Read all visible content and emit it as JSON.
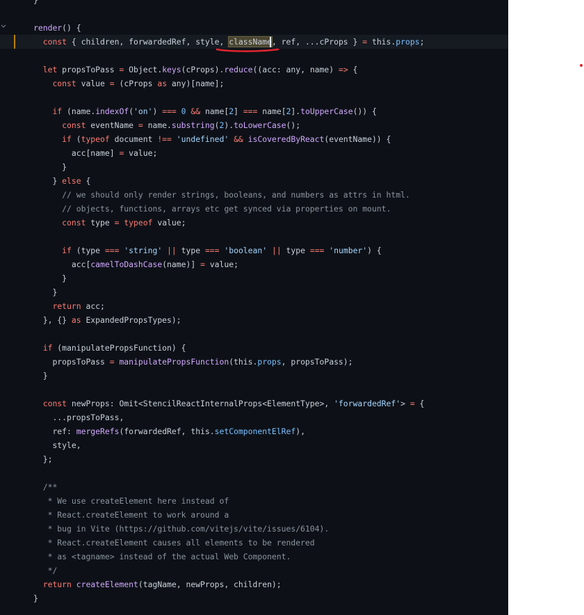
{
  "colors": {
    "editor_bg": "#0d1117",
    "keyword": "#ff7b72",
    "function": "#d2a8ff",
    "string": "#a5d6ff",
    "comment": "#8b949e",
    "property": "#79c0ff",
    "plain": "#c9d1d9",
    "annotation": "#e0242e",
    "right_panel_bg": "#ffffff"
  },
  "icons": {
    "fold": "chevron-down-icon"
  },
  "editor": {
    "lines": [
      {
        "tokens": [
          {
            "t": "    }",
            "c": "n"
          }
        ]
      },
      {
        "tokens": []
      },
      {
        "tokens": [
          {
            "t": "    ",
            "c": "n"
          },
          {
            "t": "render",
            "c": "f"
          },
          {
            "t": "() {",
            "c": "n"
          }
        ]
      },
      {
        "active": true,
        "tokens": [
          {
            "t": "      ",
            "c": "n"
          },
          {
            "t": "const",
            "c": "k"
          },
          {
            "t": " { children, forwardedRef, style, ",
            "c": "n"
          },
          {
            "t": "className",
            "c": "n",
            "hl": true
          },
          {
            "t": ", ref, ...cProps } ",
            "c": "n"
          },
          {
            "t": "=",
            "c": "o"
          },
          {
            "t": " this.",
            "c": "n"
          },
          {
            "t": "props",
            "c": "p"
          },
          {
            "t": ";",
            "c": "n"
          }
        ]
      },
      {
        "tokens": []
      },
      {
        "tokens": [
          {
            "t": "      ",
            "c": "n"
          },
          {
            "t": "let",
            "c": "k"
          },
          {
            "t": " propsToPass ",
            "c": "n"
          },
          {
            "t": "=",
            "c": "o"
          },
          {
            "t": " Object.",
            "c": "n"
          },
          {
            "t": "keys",
            "c": "f"
          },
          {
            "t": "(cProps).",
            "c": "n"
          },
          {
            "t": "reduce",
            "c": "f"
          },
          {
            "t": "((acc: any, name) ",
            "c": "n"
          },
          {
            "t": "=>",
            "c": "k"
          },
          {
            "t": " {",
            "c": "n"
          }
        ]
      },
      {
        "tokens": [
          {
            "t": "        ",
            "c": "n"
          },
          {
            "t": "const",
            "c": "k"
          },
          {
            "t": " value ",
            "c": "n"
          },
          {
            "t": "=",
            "c": "o"
          },
          {
            "t": " (cProps ",
            "c": "n"
          },
          {
            "t": "as",
            "c": "k"
          },
          {
            "t": " any)[name];",
            "c": "n"
          }
        ]
      },
      {
        "tokens": []
      },
      {
        "tokens": [
          {
            "t": "        ",
            "c": "n"
          },
          {
            "t": "if",
            "c": "k"
          },
          {
            "t": " (name.",
            "c": "n"
          },
          {
            "t": "indexOf",
            "c": "f"
          },
          {
            "t": "(",
            "c": "n"
          },
          {
            "t": "'on'",
            "c": "s"
          },
          {
            "t": ") ",
            "c": "n"
          },
          {
            "t": "===",
            "c": "o"
          },
          {
            "t": " ",
            "c": "n"
          },
          {
            "t": "0",
            "c": "p"
          },
          {
            "t": " ",
            "c": "n"
          },
          {
            "t": "&&",
            "c": "o"
          },
          {
            "t": " name[",
            "c": "n"
          },
          {
            "t": "2",
            "c": "p"
          },
          {
            "t": "] ",
            "c": "n"
          },
          {
            "t": "===",
            "c": "o"
          },
          {
            "t": " name[",
            "c": "n"
          },
          {
            "t": "2",
            "c": "p"
          },
          {
            "t": "].",
            "c": "n"
          },
          {
            "t": "toUpperCase",
            "c": "f"
          },
          {
            "t": "()) {",
            "c": "n"
          }
        ]
      },
      {
        "tokens": [
          {
            "t": "          ",
            "c": "n"
          },
          {
            "t": "const",
            "c": "k"
          },
          {
            "t": " eventName ",
            "c": "n"
          },
          {
            "t": "=",
            "c": "o"
          },
          {
            "t": " name.",
            "c": "n"
          },
          {
            "t": "substring",
            "c": "f"
          },
          {
            "t": "(",
            "c": "n"
          },
          {
            "t": "2",
            "c": "p"
          },
          {
            "t": ").",
            "c": "n"
          },
          {
            "t": "toLowerCase",
            "c": "f"
          },
          {
            "t": "();",
            "c": "n"
          }
        ]
      },
      {
        "tokens": [
          {
            "t": "          ",
            "c": "n"
          },
          {
            "t": "if",
            "c": "k"
          },
          {
            "t": " (",
            "c": "n"
          },
          {
            "t": "typeof",
            "c": "k"
          },
          {
            "t": " document ",
            "c": "n"
          },
          {
            "t": "!==",
            "c": "o"
          },
          {
            "t": " ",
            "c": "n"
          },
          {
            "t": "'undefined'",
            "c": "s"
          },
          {
            "t": " ",
            "c": "n"
          },
          {
            "t": "&&",
            "c": "o"
          },
          {
            "t": " ",
            "c": "n"
          },
          {
            "t": "isCoveredByReact",
            "c": "f"
          },
          {
            "t": "(eventName)) {",
            "c": "n"
          }
        ]
      },
      {
        "tokens": [
          {
            "t": "            acc[name] ",
            "c": "n"
          },
          {
            "t": "=",
            "c": "o"
          },
          {
            "t": " value;",
            "c": "n"
          }
        ]
      },
      {
        "tokens": [
          {
            "t": "          }",
            "c": "n"
          }
        ]
      },
      {
        "tokens": [
          {
            "t": "        } ",
            "c": "n"
          },
          {
            "t": "else",
            "c": "k"
          },
          {
            "t": " {",
            "c": "n"
          }
        ]
      },
      {
        "tokens": [
          {
            "t": "          ",
            "c": "n"
          },
          {
            "t": "// we should only render strings, booleans, and numbers as attrs in html.",
            "c": "c"
          }
        ]
      },
      {
        "tokens": [
          {
            "t": "          ",
            "c": "n"
          },
          {
            "t": "// objects, functions, arrays etc get synced via properties on mount.",
            "c": "c"
          }
        ]
      },
      {
        "tokens": [
          {
            "t": "          ",
            "c": "n"
          },
          {
            "t": "const",
            "c": "k"
          },
          {
            "t": " type ",
            "c": "n"
          },
          {
            "t": "=",
            "c": "o"
          },
          {
            "t": " ",
            "c": "n"
          },
          {
            "t": "typeof",
            "c": "k"
          },
          {
            "t": " value;",
            "c": "n"
          }
        ]
      },
      {
        "tokens": []
      },
      {
        "tokens": [
          {
            "t": "          ",
            "c": "n"
          },
          {
            "t": "if",
            "c": "k"
          },
          {
            "t": " (type ",
            "c": "n"
          },
          {
            "t": "===",
            "c": "o"
          },
          {
            "t": " ",
            "c": "n"
          },
          {
            "t": "'string'",
            "c": "s"
          },
          {
            "t": " ",
            "c": "n"
          },
          {
            "t": "||",
            "c": "o"
          },
          {
            "t": " type ",
            "c": "n"
          },
          {
            "t": "===",
            "c": "o"
          },
          {
            "t": " ",
            "c": "n"
          },
          {
            "t": "'boolean'",
            "c": "s"
          },
          {
            "t": " ",
            "c": "n"
          },
          {
            "t": "||",
            "c": "o"
          },
          {
            "t": " type ",
            "c": "n"
          },
          {
            "t": "===",
            "c": "o"
          },
          {
            "t": " ",
            "c": "n"
          },
          {
            "t": "'number'",
            "c": "s"
          },
          {
            "t": ") {",
            "c": "n"
          }
        ]
      },
      {
        "tokens": [
          {
            "t": "            acc[",
            "c": "n"
          },
          {
            "t": "camelToDashCase",
            "c": "f"
          },
          {
            "t": "(name)] ",
            "c": "n"
          },
          {
            "t": "=",
            "c": "o"
          },
          {
            "t": " value;",
            "c": "n"
          }
        ]
      },
      {
        "tokens": [
          {
            "t": "          }",
            "c": "n"
          }
        ]
      },
      {
        "tokens": [
          {
            "t": "        }",
            "c": "n"
          }
        ]
      },
      {
        "tokens": [
          {
            "t": "        ",
            "c": "n"
          },
          {
            "t": "return",
            "c": "k"
          },
          {
            "t": " acc;",
            "c": "n"
          }
        ]
      },
      {
        "tokens": [
          {
            "t": "      }, {} ",
            "c": "n"
          },
          {
            "t": "as",
            "c": "k"
          },
          {
            "t": " ExpandedPropsTypes);",
            "c": "n"
          }
        ]
      },
      {
        "tokens": []
      },
      {
        "tokens": [
          {
            "t": "      ",
            "c": "n"
          },
          {
            "t": "if",
            "c": "k"
          },
          {
            "t": " (manipulatePropsFunction) {",
            "c": "n"
          }
        ]
      },
      {
        "tokens": [
          {
            "t": "        propsToPass ",
            "c": "n"
          },
          {
            "t": "=",
            "c": "o"
          },
          {
            "t": " ",
            "c": "n"
          },
          {
            "t": "manipulatePropsFunction",
            "c": "f"
          },
          {
            "t": "(this.",
            "c": "n"
          },
          {
            "t": "props",
            "c": "p"
          },
          {
            "t": ", propsToPass);",
            "c": "n"
          }
        ]
      },
      {
        "tokens": [
          {
            "t": "      }",
            "c": "n"
          }
        ]
      },
      {
        "tokens": []
      },
      {
        "tokens": [
          {
            "t": "      ",
            "c": "n"
          },
          {
            "t": "const",
            "c": "k"
          },
          {
            "t": " newProps: Omit<StencilReactInternalProps<ElementType>, ",
            "c": "n"
          },
          {
            "t": "'forwardedRef'",
            "c": "s"
          },
          {
            "t": "> ",
            "c": "n"
          },
          {
            "t": "=",
            "c": "o"
          },
          {
            "t": " {",
            "c": "n"
          }
        ]
      },
      {
        "tokens": [
          {
            "t": "        ...propsToPass,",
            "c": "n"
          }
        ]
      },
      {
        "tokens": [
          {
            "t": "        ref: ",
            "c": "n"
          },
          {
            "t": "mergeRefs",
            "c": "f"
          },
          {
            "t": "(forwardedRef, this.",
            "c": "n"
          },
          {
            "t": "setComponentElRef",
            "c": "p"
          },
          {
            "t": "),",
            "c": "n"
          }
        ]
      },
      {
        "tokens": [
          {
            "t": "        style,",
            "c": "n"
          }
        ]
      },
      {
        "tokens": [
          {
            "t": "      };",
            "c": "n"
          }
        ]
      },
      {
        "tokens": []
      },
      {
        "tokens": [
          {
            "t": "      ",
            "c": "n"
          },
          {
            "t": "/**",
            "c": "c"
          }
        ]
      },
      {
        "tokens": [
          {
            "t": "       ",
            "c": "n"
          },
          {
            "t": "* We use createElement here instead of",
            "c": "c"
          }
        ]
      },
      {
        "tokens": [
          {
            "t": "       ",
            "c": "n"
          },
          {
            "t": "* React.createElement to work around a",
            "c": "c"
          }
        ]
      },
      {
        "tokens": [
          {
            "t": "       ",
            "c": "n"
          },
          {
            "t": "* bug in Vite (https://github.com/vitejs/vite/issues/6104).",
            "c": "c"
          }
        ]
      },
      {
        "tokens": [
          {
            "t": "       ",
            "c": "n"
          },
          {
            "t": "* React.createElement causes all elements to be rendered",
            "c": "c"
          }
        ]
      },
      {
        "tokens": [
          {
            "t": "       ",
            "c": "n"
          },
          {
            "t": "* as <tagname> instead of the actual Web Component.",
            "c": "c"
          }
        ]
      },
      {
        "tokens": [
          {
            "t": "       ",
            "c": "n"
          },
          {
            "t": "*/",
            "c": "c"
          }
        ]
      },
      {
        "tokens": [
          {
            "t": "      ",
            "c": "n"
          },
          {
            "t": "return",
            "c": "k"
          },
          {
            "t": " ",
            "c": "n"
          },
          {
            "t": "createElement",
            "c": "f"
          },
          {
            "t": "(tagName, newProps, children);",
            "c": "n"
          }
        ]
      },
      {
        "tokens": [
          {
            "t": "    }",
            "c": "n"
          }
        ]
      }
    ]
  }
}
